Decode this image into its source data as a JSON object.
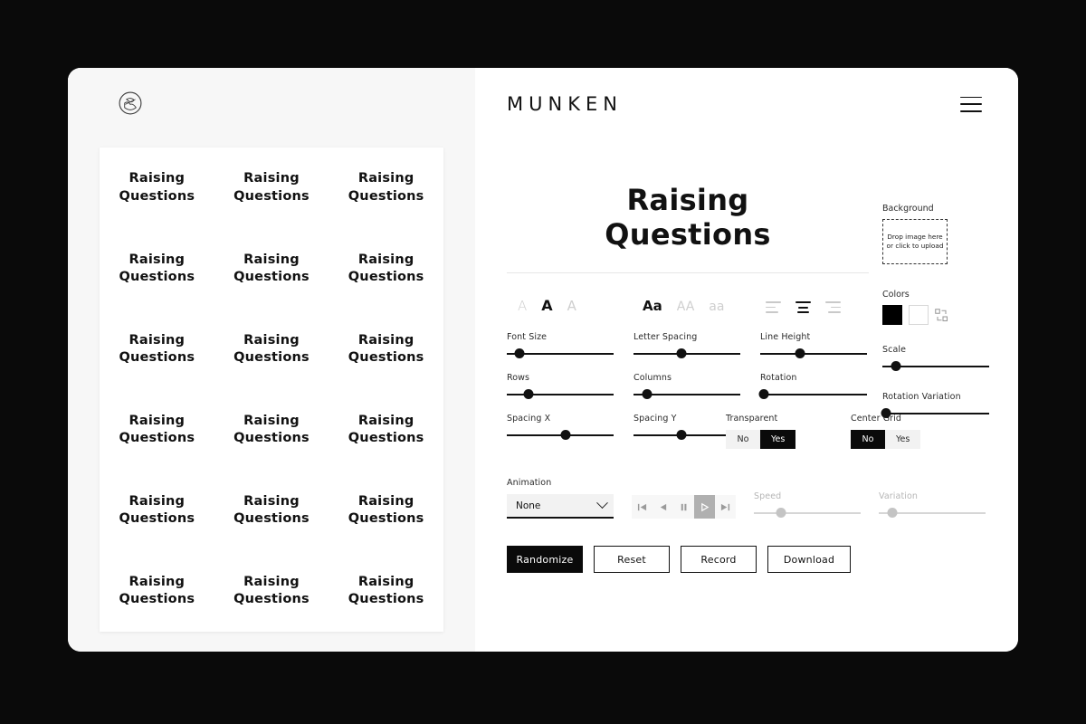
{
  "brand": {
    "name": "MUNKEN",
    "menu_icon": "hamburger-icon",
    "logo_icon": "circular-logo-mark"
  },
  "headline": {
    "line1": "Raising",
    "line2": "Questions"
  },
  "preview": {
    "cell_line1": "Raising",
    "cell_line2": "Questions",
    "rows": 6,
    "columns": 3
  },
  "typography": {
    "weight_options": [
      {
        "glyph": "A",
        "state": "inactive"
      },
      {
        "glyph": "A",
        "state": "active"
      },
      {
        "glyph": "A",
        "state": "inactive"
      }
    ],
    "case_options": [
      {
        "glyph": "Aa",
        "state": "active"
      },
      {
        "glyph": "AA",
        "state": "inactive"
      },
      {
        "glyph": "aa",
        "state": "inactive"
      }
    ],
    "align_options": [
      {
        "name": "align-left",
        "state": "inactive"
      },
      {
        "name": "align-center",
        "state": "active"
      },
      {
        "name": "align-right",
        "state": "inactive"
      }
    ]
  },
  "sliders": [
    {
      "label": "Font Size",
      "value": 12,
      "disabled": false
    },
    {
      "label": "Letter Spacing",
      "value": 45,
      "disabled": false
    },
    {
      "label": "Line Height",
      "value": 37,
      "disabled": false
    },
    {
      "label": "Scale",
      "value": 13,
      "disabled": false
    },
    {
      "label": "Rows",
      "value": 20,
      "disabled": false
    },
    {
      "label": "Columns",
      "value": 13,
      "disabled": false
    },
    {
      "label": "Rotation",
      "value": 3,
      "disabled": false
    },
    {
      "label": "Rotation Variation",
      "value": 3,
      "disabled": false
    },
    {
      "label": "Spacing X",
      "value": 55,
      "disabled": false
    },
    {
      "label": "Spacing Y",
      "value": 45,
      "disabled": false
    },
    {
      "label": "Speed",
      "value": 25,
      "disabled": true
    },
    {
      "label": "Variation",
      "value": 13,
      "disabled": true
    }
  ],
  "background": {
    "label": "Background",
    "dropzone_text": "Drop image here or click to upload"
  },
  "colors": {
    "label": "Colors",
    "swatch_primary": "#000000",
    "swatch_secondary": "#FFFFFF",
    "swap_icon": "swap-colors-icon"
  },
  "toggles": {
    "transparent": {
      "label": "Transparent",
      "options": [
        "No",
        "Yes"
      ],
      "selected": "Yes"
    },
    "center_grid": {
      "label": "Center Grid",
      "options": [
        "No",
        "Yes"
      ],
      "selected": "No"
    }
  },
  "animation": {
    "label": "Animation",
    "selected": "None",
    "transport": [
      {
        "name": "skip-to-start-icon",
        "active": false
      },
      {
        "name": "step-back-icon",
        "active": false
      },
      {
        "name": "pause-icon",
        "active": false
      },
      {
        "name": "play-icon",
        "active": true
      },
      {
        "name": "skip-to-end-icon",
        "active": false
      }
    ]
  },
  "actions": {
    "randomize": "Randomize",
    "reset": "Reset",
    "record": "Record",
    "download": "Download"
  }
}
